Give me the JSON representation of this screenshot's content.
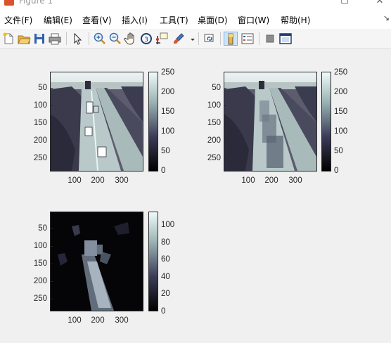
{
  "window": {
    "title": "Figure 1"
  },
  "menu": [
    "文件(F)",
    "编辑(E)",
    "查看(V)",
    "插入(I)",
    "工具(T)",
    "桌面(D)",
    "窗口(W)",
    "帮助(H)"
  ],
  "toolbar": {
    "icons": [
      "new-figure-icon",
      "open-file-icon",
      "save-icon",
      "print-icon",
      "pointer-icon",
      "zoom-in-icon",
      "zoom-out-icon",
      "pan-hand-icon",
      "rotate-3d-icon",
      "data-cursor-icon",
      "brush-icon",
      "brush-dropdown-icon",
      "link-plot-icon",
      "colorbar-icon",
      "legend-icon",
      "hide-plot-tools-icon",
      "show-plot-tools-icon"
    ],
    "colorbar_toggled": true
  },
  "plots": [
    {
      "name": "original-frame",
      "yticks": [
        "50",
        "100",
        "150",
        "200",
        "250"
      ],
      "xticks": [
        "100",
        "200",
        "300"
      ],
      "colorbar_ticks": [
        "0",
        "50",
        "100",
        "150",
        "200",
        "250"
      ]
    },
    {
      "name": "blurred-frame",
      "yticks": [
        "50",
        "100",
        "150",
        "200",
        "250"
      ],
      "xticks": [
        "100",
        "200",
        "300"
      ],
      "colorbar_ticks": [
        "0",
        "50",
        "100",
        "150",
        "200",
        "250"
      ]
    },
    {
      "name": "difference-frame",
      "yticks": [
        "50",
        "100",
        "150",
        "200",
        "250"
      ],
      "xticks": [
        "100",
        "200",
        "300"
      ],
      "colorbar_ticks": [
        "0",
        "20",
        "40",
        "60",
        "80",
        "100"
      ]
    }
  ],
  "colors": {
    "background": "#f0f0f0",
    "colormap_low": "#000000",
    "colormap_high": "#e6f2f2"
  }
}
